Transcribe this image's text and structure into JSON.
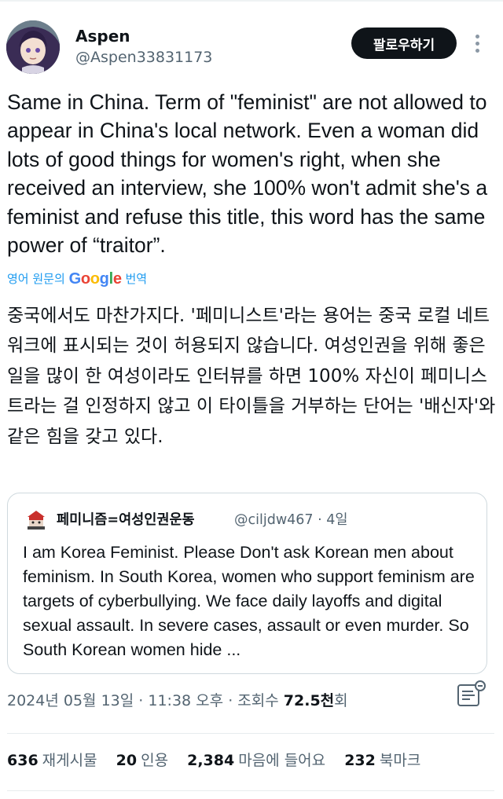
{
  "author": {
    "name": "Aspen",
    "handle": "@Aspen33831173",
    "avatar_icon": "anime-avatar-icon"
  },
  "follow_button_label": "팔로우하기",
  "more_icon": "more-vertical-icon",
  "tweet_text": "Same in China. Term of \"feminist\" are not allowed to appear in China's local network. Even a woman did lots of good things for women's right, when she received an interview, she 100% won't admit she's a feminist and refuse this title, this word has the same power of “traitor”.",
  "translation": {
    "prefix": "영어 원문의",
    "brand": "Google",
    "suffix": "번역",
    "text": "중국에서도 마찬가지다. '페미니스트'라는 용어는 중국 로컬 네트워크에 표시되는 것이 허용되지 않습니다. 여성인권을 위해 좋은 일을 많이 한 여성이라도 인터뷰를 하면 100% 자신이 페미니스트라는 걸 인정하지 않고 이 타이틀을 거부하는 단어는 '배신자'와 같은 힘을 갖고 있다.",
    "google_colors": [
      "#4285f4",
      "#ea4335",
      "#fbbc05",
      "#4285f4",
      "#34a853",
      "#ea4335"
    ]
  },
  "quote": {
    "name": "페미니즘=여성인권운동",
    "handle": "@ciljdw467",
    "separator": "·",
    "time": "4일",
    "text": "I am Korea Feminist. Please Don't ask Korean men about feminism. In South Korea, women who support feminism are targets of cyberbullying. We face daily layoffs and digital sexual assault. In severe cases, assault or even murder. So South Korean women hide ..."
  },
  "meta": {
    "date": "2024년 05월 13일",
    "separator": "·",
    "time": "11:38 오후",
    "views_label": "조회수",
    "views_value": "72.5천",
    "views_suffix": "회",
    "analytics_icon": "analytics-icon"
  },
  "stats": [
    {
      "value": "636",
      "label": "재게시물"
    },
    {
      "value": "20",
      "label": "인용"
    },
    {
      "value": "2,384",
      "label": "마음에 들어요"
    },
    {
      "value": "232",
      "label": "북마크"
    }
  ],
  "colors": {
    "text": "#0f1419",
    "secondary": "#536471",
    "link": "#1d9bf0",
    "border": "#cfd9de",
    "button_bg": "#0f1419"
  }
}
